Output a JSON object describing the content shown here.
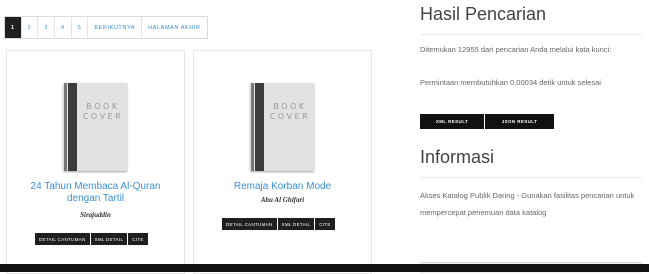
{
  "pagination": {
    "pages": [
      "1",
      "2",
      "3",
      "4",
      "5"
    ],
    "active": "1",
    "next_label": "BERIKUTNYA",
    "last_label": "HALAMAN AKHIR"
  },
  "books": [
    {
      "cover_text": "BOOK\nCOVER",
      "title": "24 Tahun Membaca Al-Quran dengan Tartil",
      "author": "Sirajuddin",
      "buttons": [
        "DETAIL CANTUMAN",
        "XML DETAIL",
        "CITE"
      ]
    },
    {
      "cover_text": "BOOK\nCOVER",
      "title": "Remaja Korban Mode",
      "author": "Abu Al Ghifari",
      "buttons": [
        "DETAIL CANTUMAN",
        "XML DETAIL",
        "CITE"
      ]
    }
  ],
  "search_result": {
    "heading": "Hasil Pencarian",
    "found_text": "Ditemukan 12955 dari pencarian Anda melalui kata kunci:",
    "time_text": "Permintaan membutuhkan 0.00034 detik untuk selesai",
    "xml_button": "XML RESULT",
    "json_button": "JSON RESULT"
  },
  "info": {
    "heading": "Informasi",
    "text": "Akses Katalog Publik Daring - Gunakan fasilitas pencarian untuk mempercepat penemuan data katalog"
  },
  "colors": {
    "link": "#3a8fd8",
    "dark": "#1f1f1f"
  }
}
